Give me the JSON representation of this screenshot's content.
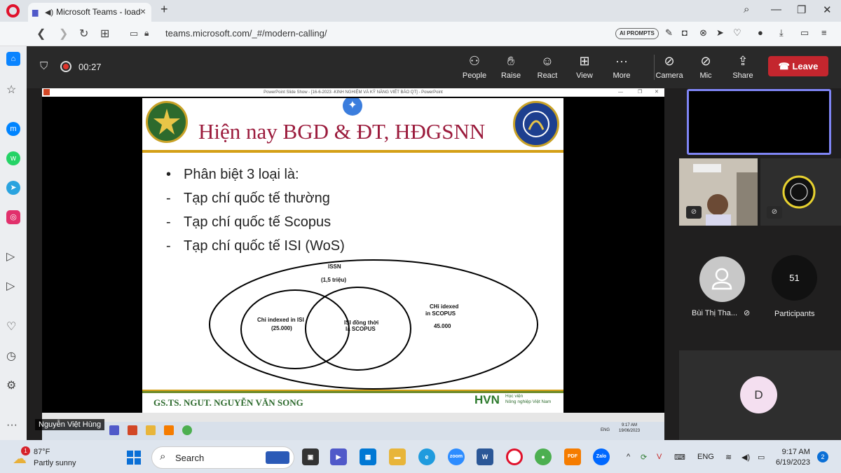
{
  "browser": {
    "tab_title": "Microsoft Teams - loadi",
    "url": "teams.microsoft.com/_#/modern-calling/",
    "ai_prompts_label": "AI PROMPTS"
  },
  "call": {
    "timer": "00:27",
    "controls": [
      {
        "label": "People",
        "icon": "people-icon"
      },
      {
        "label": "Raise",
        "icon": "hand-icon"
      },
      {
        "label": "React",
        "icon": "smile-icon"
      },
      {
        "label": "View",
        "icon": "grid-icon"
      },
      {
        "label": "More",
        "icon": "more-icon"
      },
      {
        "label": "Camera",
        "icon": "camera-off-icon"
      },
      {
        "label": "Mic",
        "icon": "mic-off-icon"
      },
      {
        "label": "Share",
        "icon": "share-icon"
      }
    ],
    "leave_label": "Leave",
    "presenter_name": "Nguyễn Việt Hùng"
  },
  "ppt": {
    "window_title": "PowerPoint Slide Show - [16-6-2023 -KINH NGHIỆM VÀ KỸ NĂNG VIẾT BÁO QT] - PowerPoint"
  },
  "slide": {
    "title": "Hiện nay BGD & ĐT, HĐGSNN",
    "bullets": [
      {
        "marker": "•",
        "text": "Phân biệt 3 loại là:"
      },
      {
        "marker": "-",
        "text": "Tạp chí quốc tế thường"
      },
      {
        "marker": "-",
        "text": "Tạp chí quốc tế Scopus"
      },
      {
        "marker": "-",
        "text": "Tạp chí quốc tế ISI (WoS)"
      }
    ],
    "venn": {
      "issn_label": "ISSN",
      "issn_count": "(1,5 triệu)",
      "isi_only_label": "Chỉ  indexed in ISI",
      "isi_only_count": "(25.000)",
      "both_label_1": "ISI đồng thời",
      "both_label_2": "là  SCOPUS",
      "scopus_only_label_1": "CHỉ idexed",
      "scopus_only_label_2": "in  SCOPUS",
      "scopus_only_count": "45.000"
    },
    "footer_author": "GS.TS. NGUT. NGUYỄN VĂN SONG",
    "footer_brand": "HVN",
    "footer_brand_sub_1": "Học viện",
    "footer_brand_sub_2": "Nông nghiệp Việt Nam"
  },
  "remote_taskbar": {
    "time": "9:17 AM",
    "date": "19/06/2023",
    "lang": "ENG"
  },
  "participants": {
    "p1_name": "Bùi Thị Tha...",
    "count": "51",
    "count_label": "Participants",
    "d_initial": "D"
  },
  "taskbar": {
    "temperature": "87°F",
    "weather": "Partly sunny",
    "weather_badge": "1",
    "search_label": "Search",
    "lang": "ENG",
    "time": "9:17 AM",
    "date": "6/19/2023",
    "notifications": "2"
  },
  "colors": {
    "leave_red": "#c4262e",
    "slide_title": "#9b1b3c",
    "accent_green": "#2d6a2d",
    "self_tile_border": "#7f85f5"
  }
}
